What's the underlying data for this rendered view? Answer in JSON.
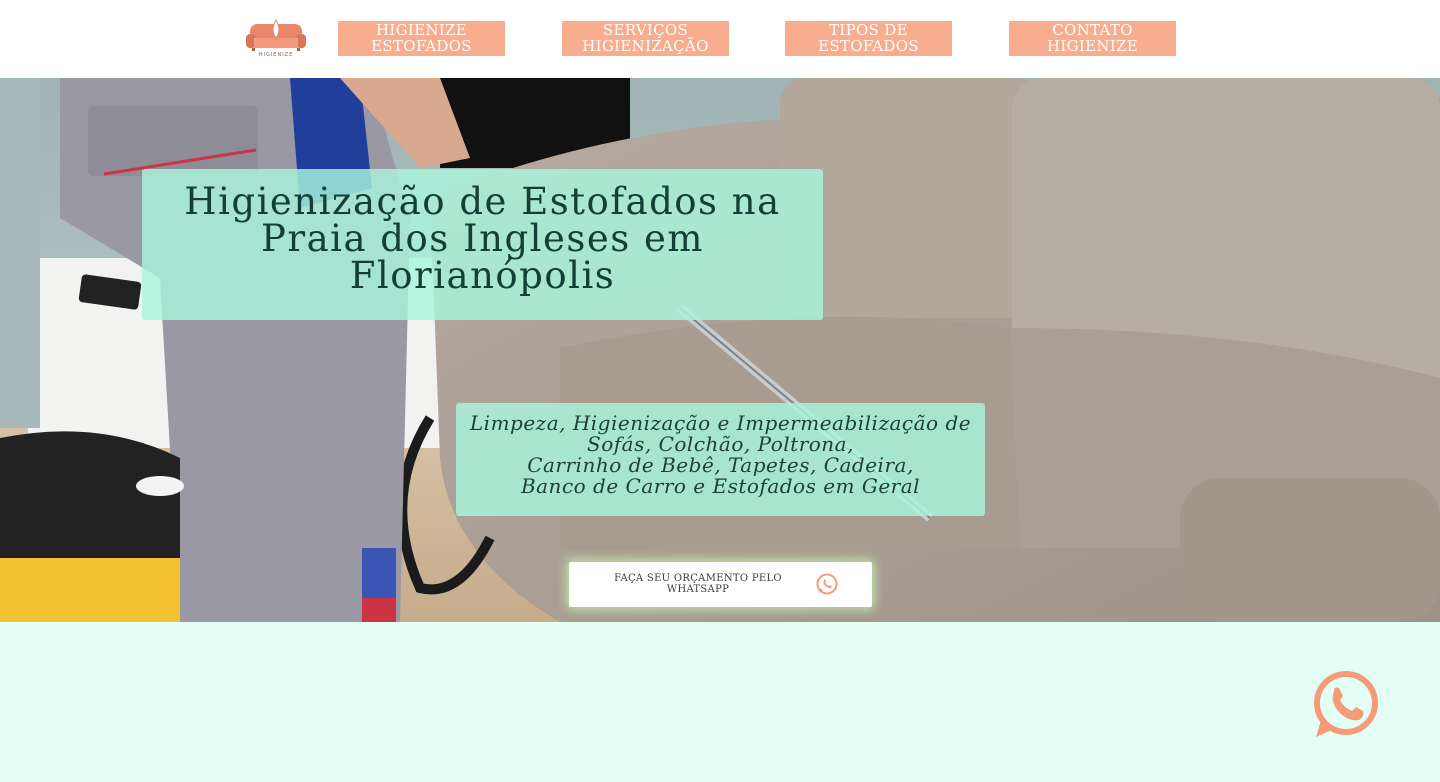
{
  "header": {
    "logo_text": "HIGIENIZE",
    "nav": [
      {
        "label": "HIGIENIZE\nESTOFADOS"
      },
      {
        "label": "SERVIÇOS\nHIGIENIZAÇÃO"
      },
      {
        "label": "TIPOS DE\nESTOFADOS"
      },
      {
        "label": "CONTATO\nHIGIENIZE"
      }
    ]
  },
  "hero": {
    "title": "Higienização de Estofados na Praia dos Ingleses em Florianópolis",
    "subtitle": "Limpeza, Higienização e Impermeabilização de\nSofás, Colchão, Poltrona,\nCarrinho de Bebê, Tapetes, Cadeira,\nBanco de Carro e Estofados em Geral",
    "cta_label": "FAÇA SEU ORÇAMENTO PELO WHATSAPP",
    "cta_icon": "whatsapp-icon"
  },
  "floating": {
    "icon": "whatsapp-icon"
  },
  "colors": {
    "nav_bg": "#f8ad8e",
    "box_bg": "#a8f5dc",
    "lower_bg": "#e3fff5",
    "whatsapp_orange": "#f59b78"
  }
}
